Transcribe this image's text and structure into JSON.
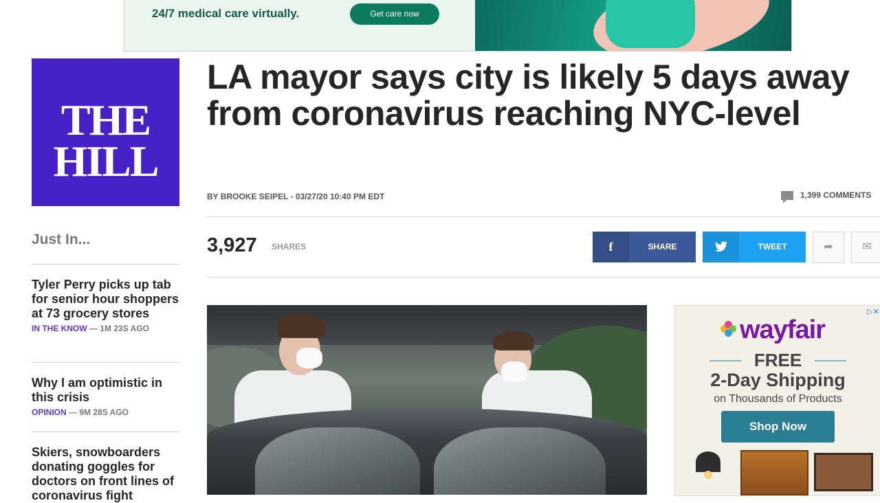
{
  "top_ad": {
    "text": "24/7 medical care virtually.",
    "button": "Get care now"
  },
  "logo": {
    "line1": "THE",
    "line2": "HILL"
  },
  "article": {
    "headline": "LA mayor says city is likely 5 days away from coronavirus reaching NYC-level",
    "byline": "BY BROOKE SEIPEL - 03/27/20 10:40 PM EDT",
    "comments": "1,399 COMMENTS",
    "share_count": "3,927",
    "shares_label": "SHARES",
    "facebook_label": "SHARE",
    "twitter_label": "TWEET"
  },
  "sidebar": {
    "heading": "Just In...",
    "items": [
      {
        "title": "Tyler Perry picks up tab for senior hour shoppers at 73 grocery stores",
        "category": "IN THE KNOW",
        "time": "— 1M 23S AGO"
      },
      {
        "title": "Why I am optimistic in this crisis",
        "category": "OPINION",
        "time": "— 9M 28S AGO"
      },
      {
        "title": "Skiers, snowboarders donating goggles for doctors on front lines of coronavirus fight",
        "category": "",
        "time": ""
      }
    ]
  },
  "right_ad": {
    "brand": "wayfair",
    "line1": "FREE",
    "line2": "2-Day Shipping",
    "line3": "on Thousands of Products",
    "button": "Shop Now"
  },
  "colors": {
    "logo_bg": "#4720c8",
    "facebook": "#3b5998",
    "twitter": "#1da1f2",
    "category": "#5b39c7",
    "wayfair": "#7b189f"
  },
  "icons": [
    "facebook-icon",
    "twitter-icon",
    "share-arrow-icon",
    "mail-icon",
    "comment-icon",
    "ad-choices-icon"
  ]
}
